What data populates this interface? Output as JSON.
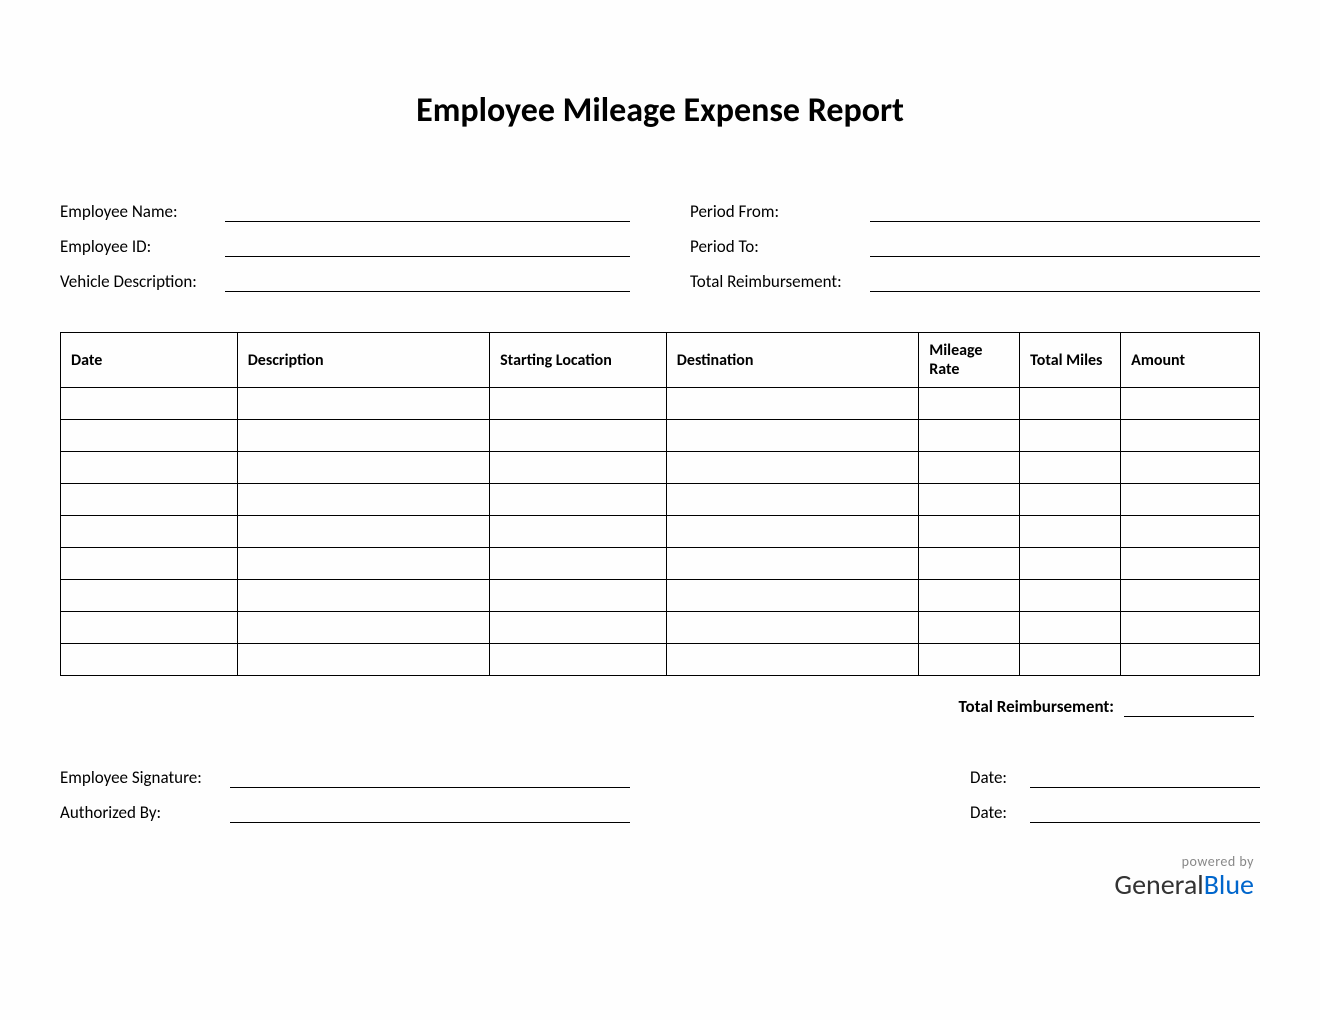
{
  "title": "Employee Mileage Expense Report",
  "info_left": {
    "employee_name_label": "Employee Name:",
    "employee_id_label": "Employee ID:",
    "vehicle_desc_label": "Vehicle Description:"
  },
  "info_right": {
    "period_from_label": "Period From:",
    "period_to_label": "Period To:",
    "total_reimb_label": "Total Reimbursement:"
  },
  "table": {
    "headers": {
      "date": "Date",
      "description": "Description",
      "starting_location": "Starting Location",
      "destination": "Destination",
      "mileage_rate": "Mileage Rate",
      "total_miles": "Total Miles",
      "amount": "Amount"
    },
    "row_count": 9
  },
  "total_reimbursement_label": "Total Reimbursement:",
  "signatures": {
    "employee_sig_label": "Employee Signature:",
    "authorized_by_label": "Authorized By:",
    "date_label": "Date:"
  },
  "footer": {
    "powered_by": "powered by",
    "brand_general": "General",
    "brand_blue": "Blue"
  }
}
